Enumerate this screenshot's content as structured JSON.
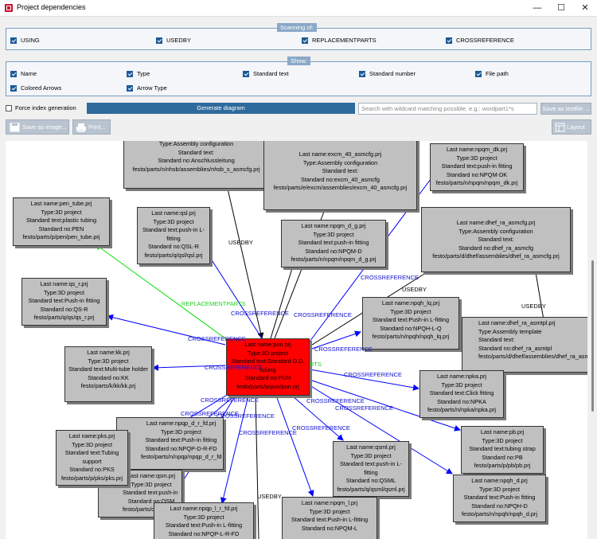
{
  "window": {
    "title": "Project dependencies",
    "minimize": "—",
    "maximize": "☐",
    "close": "✕"
  },
  "scanning": {
    "title": "Scanning of:",
    "items": [
      {
        "label": "USING",
        "checked": true
      },
      {
        "label": "USEDBY",
        "checked": true
      },
      {
        "label": "REPLACEMENTPARTS",
        "checked": true
      },
      {
        "label": "CROSSREFERENCE",
        "checked": true
      }
    ]
  },
  "show": {
    "title": "Show:",
    "items": [
      {
        "label": "Name",
        "checked": true
      },
      {
        "label": "Type",
        "checked": true
      },
      {
        "label": "Standard text",
        "checked": true
      },
      {
        "label": "Standard number",
        "checked": true
      },
      {
        "label": "File path",
        "checked": true
      },
      {
        "label": "Colored Arrows",
        "checked": true
      },
      {
        "label": "Arrow Type",
        "checked": true
      }
    ]
  },
  "actions": {
    "force_index": "Force index generation",
    "generate": "Generate diagram",
    "search_placeholder": "Search with wildcard matching possible, e.g.: wordpart1*s",
    "save_textfile": "Save as textfile ...",
    "save_image": "Save as image...",
    "print": "Print...",
    "layout": "Layout"
  },
  "colors": {
    "using": "#000000",
    "crossreference": "#0000ff",
    "replacement": "#00dd00",
    "main_node": "#ff0000"
  },
  "diagram": {
    "nodes": [
      {
        "id": "nhsb",
        "lines": [
          "Type:Assembly configuration",
          "Standard text:",
          "Standard no:Anschlussleitung",
          "festo/parts/n/nhsb/assemblies/nhsb_s_asmcfg.prj"
        ]
      },
      {
        "id": "excm",
        "lines": [
          "Last name:excm_40_asmcfg.prj",
          "Type:Assembly configuration",
          "Standard text:",
          "Standard no:excm_40_asmcfg",
          "festo/parts/e/excm/assemblies/excm_40_asmcfg.prj"
        ]
      },
      {
        "id": "npqmdk",
        "lines": [
          "Last name:npqm_dk.prj",
          "Type:3D project",
          "Standard text:push-in fitting",
          "Standard no:NPQM-DK",
          "festo/parts/n/npqm/npqm_dk.prj"
        ]
      },
      {
        "id": "pen",
        "lines": [
          "Last name:pen_tube.prj",
          "Type:3D project",
          "Standard text:plastic tubing",
          "Standard no:PEN",
          "festo/parts/p/pen/pen_tube.prj"
        ]
      },
      {
        "id": "qsl",
        "lines": [
          "Last name:qsl.prj",
          "Type:3D project",
          "Standard text:push-in L-fitting",
          "Standard no:QSL-R",
          "festo/parts/q/qsl/qsl.prj"
        ]
      },
      {
        "id": "npqmdg",
        "lines": [
          "Last name:npqm_d_g.prj",
          "Type:3D project",
          "Standard text:push-in fitting",
          "Standard no:NPQM-D",
          "festo/parts/n/npqm/npqm_d_g.prj"
        ]
      },
      {
        "id": "dhef",
        "lines": [
          "Last name:dhef_ra_asmcfg.prj",
          "Type:Assembly configuration",
          "Standard text:",
          "Standard no:dhef_ra_asmcfg",
          "festo/parts/d/dhef/assemblies/dhef_ra_asmcfg.prj"
        ]
      },
      {
        "id": "qsr",
        "lines": [
          "Last name:qs_r.prj",
          "Type:3D project",
          "Standard text:Push-in fitting",
          "Standard no:QS-R",
          "festo/parts/q/qs/qs_r.prj"
        ]
      },
      {
        "id": "npqhlq",
        "lines": [
          "Last name:npqh_lq.prj",
          "Type:3D project",
          "Standard text:Push-in L-fitting",
          "Standard no:NPQH-L-Q",
          "festo/parts/n/npqh/npqh_lq.prj"
        ]
      },
      {
        "id": "dhefmpl",
        "lines": [
          "Last name:dhef_ra_asmtpl.prj",
          "Type:Assembly template",
          "Standard text:",
          "Standard no:dhef_ra_asmtpl",
          "festo/parts/d/dhef/assemblies/dhef_ra_asmtpl.prj"
        ]
      },
      {
        "id": "kk",
        "lines": [
          "Last name:kk.prj",
          "Type:3D project",
          "Standard text:Multi-tube holder",
          "Standard no:KK",
          "festo/parts/k/kk/kk.prj"
        ]
      },
      {
        "id": "pun",
        "lines": [
          "Last name:pun.prj",
          "Type:3D project",
          "Standard text:Standard O.D. tubing",
          "Standard no:PUN",
          "festo/parts/p/pun/pun.prj"
        ]
      },
      {
        "id": "npka",
        "lines": [
          "Last name:npka.prj",
          "Type:3D project",
          "Standard text:Click fitting",
          "Standard no:NPKA",
          "festo/parts/n/npka/npka.prj"
        ]
      },
      {
        "id": "npqprfd",
        "lines": [
          "Last name:npqp_d_r_fd.prj",
          "Type:3D project",
          "Standard text:Push-in fitting",
          "Standard no:NPQP-D-R-FD",
          "festo/parts/n/npqp/npqp_d_r_fd.prj"
        ]
      },
      {
        "id": "pks",
        "lines": [
          "Last name:pks.prj",
          "Type:3D project",
          "Standard text:Tubing support",
          "Standard no:PKS",
          "festo/parts/p/pks/pks.prj"
        ]
      },
      {
        "id": "qsm",
        "lines": [
          "Last name:qsm.prj",
          "Type:3D project",
          "Standard text:push-in fitting",
          "Standard no:QSM",
          "festo/parts/q/qsm/qsm.prj"
        ]
      },
      {
        "id": "qsml",
        "lines": [
          "Last name:qsml.prj",
          "Type:3D project",
          "Standard text:push-in L-fitting",
          "Standard no:QSML",
          "festo/parts/q/qsml/qsml.prj"
        ]
      },
      {
        "id": "pb",
        "lines": [
          "Last name:pb.prj",
          "Type:3D project",
          "Standard text:tubing strap",
          "Standard no:PB",
          "festo/parts/p/pb/pb.prj"
        ]
      },
      {
        "id": "npqhd",
        "lines": [
          "Last name:npqh_d.prj",
          "Type:3D project",
          "Standard text:Push-in fitting",
          "Standard no:NPQH-D",
          "festo/parts/n/npqh/npqh_d.prj"
        ]
      },
      {
        "id": "npqplrfd",
        "lines": [
          "Last name:npqp_l_r_fd.prj",
          "Type:3D project",
          "Standard text:Push-in L-fitting",
          "Standard no:NPQP-L-R-FD"
        ]
      },
      {
        "id": "npqml",
        "lines": [
          "Last name:npqm_l.prj",
          "Type:3D project",
          "Standard text:Push-in L-fitting",
          "Standard no:NPQM-L"
        ]
      }
    ],
    "edge_labels": [
      {
        "id": "l1",
        "text": "USEDBY",
        "kind": "black"
      },
      {
        "id": "l2",
        "text": "CROSSREFERENCE",
        "kind": "blue"
      },
      {
        "id": "l3",
        "text": "USEDBY",
        "kind": "black"
      },
      {
        "id": "l4",
        "text": "USEDBY",
        "kind": "black"
      },
      {
        "id": "l5",
        "text": "REPLACEMENTPARTS",
        "kind": "green"
      },
      {
        "id": "l6",
        "text": "CROSSREFERENCE",
        "kind": "blue"
      },
      {
        "id": "l7",
        "text": "CROSSREFERENCE",
        "kind": "blue"
      },
      {
        "id": "l8",
        "text": "CROSSREFERENCE",
        "kind": "blue"
      },
      {
        "id": "l9",
        "text": "CROSSREFERENCE",
        "kind": "blue"
      },
      {
        "id": "l10",
        "text": "CROSSREFERENCE",
        "kind": "blue"
      },
      {
        "id": "l11",
        "text": "RTS",
        "kind": "green"
      },
      {
        "id": "l12",
        "text": "CROSSREFERENCE",
        "kind": "blue"
      },
      {
        "id": "l13",
        "text": "CROSSREFERENCE",
        "kind": "blue"
      },
      {
        "id": "l14",
        "text": "CROSSREFERENCE",
        "kind": "blue"
      },
      {
        "id": "l15",
        "text": "CROSSREFERENCE",
        "kind": "blue"
      },
      {
        "id": "l16",
        "text": "CROSSREFERENCE",
        "kind": "blue"
      },
      {
        "id": "l17",
        "text": "CROSSREFERENCE",
        "kind": "blue"
      },
      {
        "id": "l18",
        "text": "CROSSREFERENCE",
        "kind": "blue"
      },
      {
        "id": "l19",
        "text": "CROSSREFERENCE",
        "kind": "blue"
      },
      {
        "id": "l20",
        "text": "USEDBY",
        "kind": "black"
      }
    ]
  }
}
